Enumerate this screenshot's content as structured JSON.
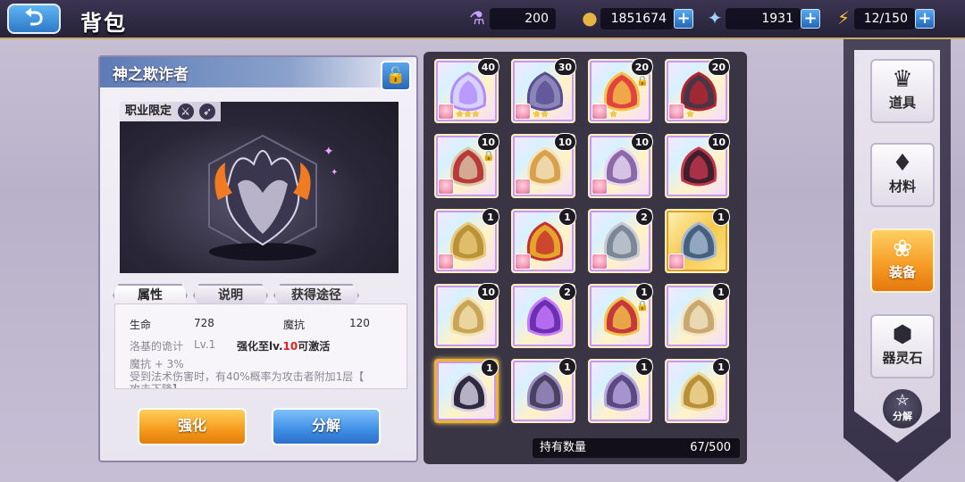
{
  "header": {
    "back_icon": "back-arrow-icon",
    "title": "背包"
  },
  "resources": {
    "potion": {
      "icon": "potion-icon",
      "value": "200"
    },
    "gold": {
      "icon": "gold-coin-icon",
      "value": "1851674"
    },
    "star": {
      "icon": "star-crystal-icon",
      "value": "1931"
    },
    "stamina": {
      "icon": "lightning-icon",
      "value": "12/150"
    }
  },
  "detail": {
    "item_name": "神之欺诈者",
    "lock_icon": "unlock-icon",
    "class_limit_label": "职业限定",
    "tabs": [
      {
        "label": "属性"
      },
      {
        "label": "说明"
      },
      {
        "label": "获得途径"
      }
    ],
    "stats": {
      "hp_label": "生命",
      "hp_value": "728",
      "mres_label": "魔抗",
      "mres_value": "120"
    },
    "set_name": "洛基的诡计",
    "set_level": "Lv.1",
    "unlock_prefix": "强化至lv.",
    "unlock_level": "10",
    "unlock_suffix": "可激活",
    "bonus_line": "魔抗 + 3%",
    "effect_line": "受到法术伤害时，有40%概率为攻击者附加1层【",
    "effect_line_cut": "攻击下降】",
    "enhance_label": "强化",
    "decompose_label": "分解"
  },
  "inventory": {
    "hold_label": "持有数量",
    "hold_value": "67/500",
    "items": [
      {
        "qty": "40",
        "avatar": true,
        "stars": "★★★",
        "lock": false
      },
      {
        "qty": "30",
        "avatar": true,
        "stars": "★★",
        "lock": false
      },
      {
        "qty": "20",
        "avatar": true,
        "stars": "★",
        "lock": true
      },
      {
        "qty": "20",
        "avatar": true,
        "stars": "★",
        "lock": false
      },
      {
        "qty": "10",
        "avatar": true,
        "stars": "",
        "lock": true
      },
      {
        "qty": "10",
        "avatar": true,
        "stars": "",
        "lock": false
      },
      {
        "qty": "10",
        "avatar": true,
        "stars": "",
        "lock": false
      },
      {
        "qty": "10",
        "avatar": false,
        "stars": "",
        "lock": false
      },
      {
        "qty": "1",
        "avatar": true,
        "stars": "",
        "lock": false
      },
      {
        "qty": "1",
        "avatar": true,
        "stars": "",
        "lock": false
      },
      {
        "qty": "2",
        "avatar": true,
        "stars": "",
        "lock": false
      },
      {
        "qty": "1",
        "avatar": true,
        "stars": "",
        "lock": false
      },
      {
        "qty": "10",
        "avatar": false,
        "stars": "",
        "lock": false
      },
      {
        "qty": "2",
        "avatar": false,
        "stars": "",
        "lock": false
      },
      {
        "qty": "1",
        "avatar": false,
        "stars": "",
        "lock": true
      },
      {
        "qty": "1",
        "avatar": false,
        "stars": "",
        "lock": false
      },
      {
        "qty": "1",
        "avatar": false,
        "stars": "",
        "lock": false
      },
      {
        "qty": "1",
        "avatar": false,
        "stars": "",
        "lock": false
      },
      {
        "qty": "1",
        "avatar": false,
        "stars": "",
        "lock": false
      },
      {
        "qty": "1",
        "avatar": false,
        "stars": "",
        "lock": false
      }
    ]
  },
  "nav": {
    "items": [
      {
        "label": "道具",
        "icon": "crown-cluster-icon"
      },
      {
        "label": "材料",
        "icon": "crystal-icon"
      },
      {
        "label": "装备",
        "icon": "flower-emblem-icon"
      },
      {
        "label": "器灵石",
        "icon": "soul-stone-icon"
      }
    ],
    "decompose_label": "分解",
    "decompose_icon": "pentagram-icon"
  }
}
